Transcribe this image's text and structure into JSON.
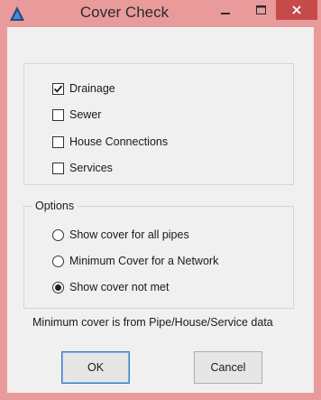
{
  "window": {
    "title": "Cover Check",
    "app_icon": "autodesk-a-icon",
    "controls": {
      "minimize": "minimize-icon",
      "maximize": "maximize-icon",
      "close": "close-icon"
    }
  },
  "types": {
    "items": [
      {
        "label": "Drainage",
        "checked": true
      },
      {
        "label": "Sewer",
        "checked": false
      },
      {
        "label": "House Connections",
        "checked": false
      },
      {
        "label": "Services",
        "checked": false
      }
    ]
  },
  "options": {
    "legend": "Options",
    "items": [
      {
        "label": "Show cover for all pipes",
        "selected": false
      },
      {
        "label": "Minimum Cover for a Network",
        "selected": false
      },
      {
        "label": "Show cover not met",
        "selected": true
      }
    ]
  },
  "info_text": "Minimum cover is from Pipe/House/Service data",
  "buttons": {
    "ok": "OK",
    "cancel": "Cancel"
  },
  "colors": {
    "frame": "#e99a9a",
    "close_button": "#c74a4a",
    "client": "#f0f0f0"
  }
}
